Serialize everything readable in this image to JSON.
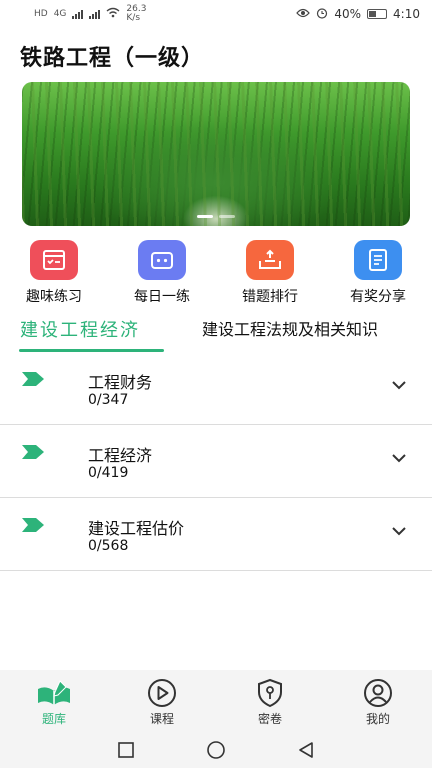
{
  "status_bar": {
    "network_label": "HD",
    "network_type": "4G",
    "speed_value": "26.3",
    "speed_unit": "K/s",
    "battery_percent": "40%",
    "time": "4:10"
  },
  "page": {
    "title": "铁路工程（一级）"
  },
  "banner": {
    "slides": 2,
    "active_slide": 1
  },
  "features": [
    {
      "label": "趣味练习",
      "icon": "checklist-icon",
      "color": "#ef4f5a"
    },
    {
      "label": "每日一练",
      "icon": "robot-face-icon",
      "color": "#6b7cf2"
    },
    {
      "label": "错题排行",
      "icon": "tray-upload-icon",
      "color": "#f6673e"
    },
    {
      "label": "有奖分享",
      "icon": "notebook-icon",
      "color": "#3d8ff0"
    }
  ],
  "tabs": {
    "active": "建设工程经济",
    "inactive": "建设工程法规及相关知识"
  },
  "list": {
    "items": [
      {
        "title": "工程财务",
        "count": "0/347"
      },
      {
        "title": "工程经济",
        "count": "0/419"
      },
      {
        "title": "建设工程估价",
        "count": "0/568"
      }
    ]
  },
  "bottom_nav": {
    "items": [
      {
        "label": "题库",
        "icon": "book-pen-icon",
        "active": true
      },
      {
        "label": "课程",
        "icon": "play-circle-icon",
        "active": false
      },
      {
        "label": "密卷",
        "icon": "shield-key-icon",
        "active": false
      },
      {
        "label": "我的",
        "icon": "user-circle-icon",
        "active": false
      }
    ]
  },
  "colors": {
    "accent": "#2db37a",
    "divider": "#dcdcdc",
    "nav_background": "#f4f4f4"
  }
}
